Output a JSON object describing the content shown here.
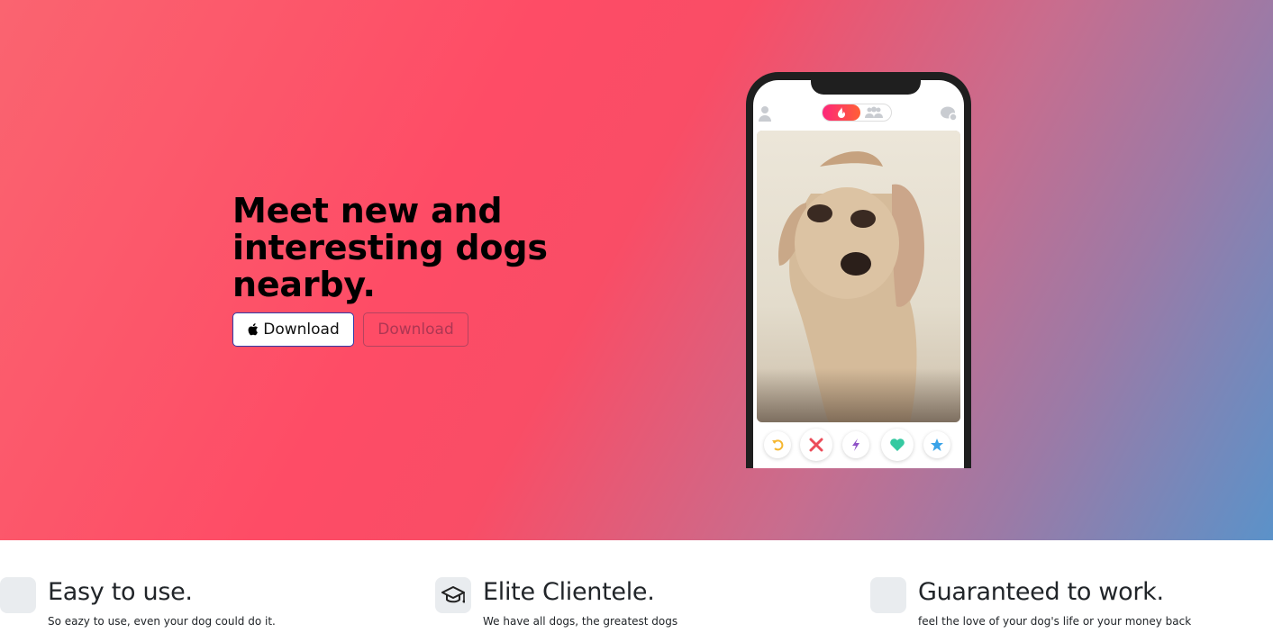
{
  "hero": {
    "title": "Meet new and interesting dogs nearby.",
    "buttons": {
      "apple_label": "Download",
      "secondary_label": "Download"
    },
    "phone": {
      "toggle_active_icon": "flame-icon",
      "toggle_inactive_icon": "group-icon",
      "photo_subject": "dog-photo",
      "actions": [
        "rewind-icon",
        "nope-icon",
        "boost-icon",
        "like-icon",
        "super-like-icon"
      ]
    }
  },
  "features": [
    {
      "icon": "blank-icon",
      "title": "Easy to use.",
      "text": "So eazy to use, even your dog could do it."
    },
    {
      "icon": "graduation-cap-icon",
      "title": "Elite Clientele.",
      "text": "We have all dogs, the greatest dogs"
    },
    {
      "icon": "blank-icon",
      "title": "Guaranteed to work.",
      "text": "feel the love of your dog's life or your money back"
    }
  ],
  "colors": {
    "hero_start": "#fa6470",
    "hero_mid": "#fe4c66",
    "hero_end": "#5b92c9",
    "apple_btn_border": "#2f3aa8",
    "feature_icon_bg": "#e9ecef",
    "text": "#212529"
  }
}
